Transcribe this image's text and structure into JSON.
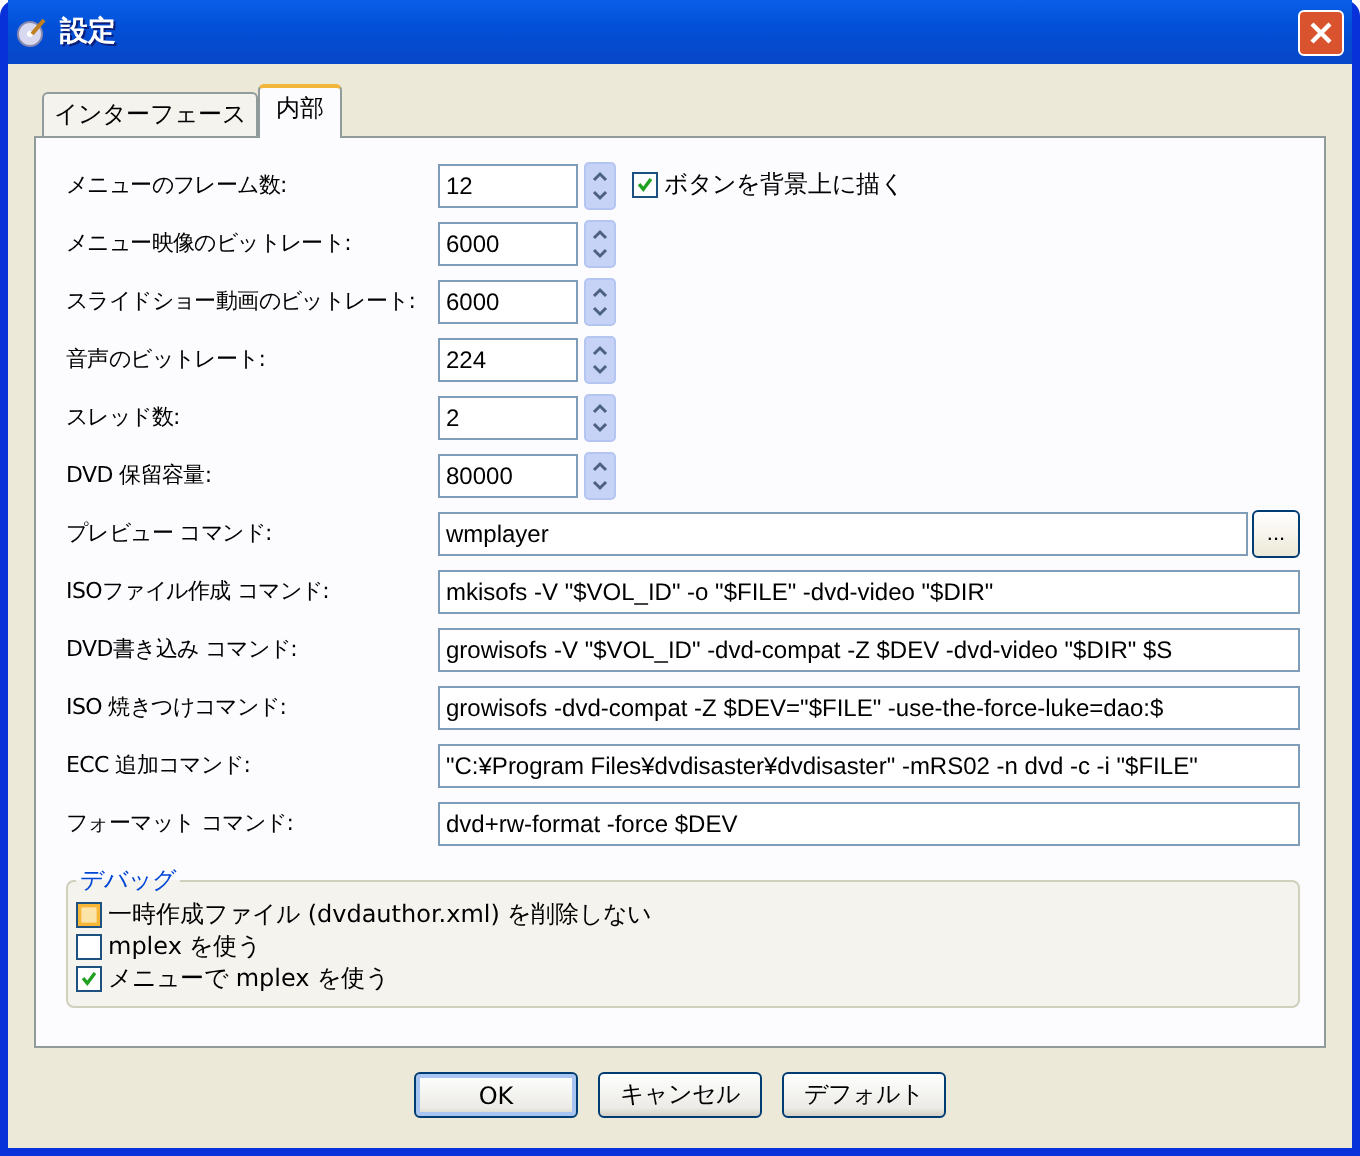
{
  "window": {
    "title": "設定"
  },
  "tabs": [
    {
      "label": "インターフェース",
      "selected": false
    },
    {
      "label": "内部",
      "selected": true
    }
  ],
  "rows": [
    {
      "label": "メニューのフレーム数:",
      "kind": "spin",
      "value": "12",
      "checkbox": {
        "label": "ボタンを背景上に描く",
        "checked": true
      }
    },
    {
      "label": "メニュー映像のビットレート:",
      "kind": "spin",
      "value": "6000"
    },
    {
      "label": "スライドショー動画のビットレート:",
      "kind": "spin",
      "value": "6000"
    },
    {
      "label": "音声のビットレート:",
      "kind": "spin",
      "value": "224"
    },
    {
      "label": "スレッド数:",
      "kind": "spin",
      "value": "2"
    },
    {
      "label": "DVD 保留容量:",
      "kind": "spin",
      "value": "80000"
    },
    {
      "label": "プレビュー コマンド:",
      "kind": "browse",
      "value": "wmplayer",
      "button": "..."
    },
    {
      "label": "ISOファイル作成 コマンド:",
      "kind": "text",
      "value": "mkisofs -V \"$VOL_ID\" -o \"$FILE\" -dvd-video \"$DIR\""
    },
    {
      "label": "DVD書き込み コマンド:",
      "kind": "text",
      "value": "growisofs -V \"$VOL_ID\" -dvd-compat -Z $DEV -dvd-video \"$DIR\" $S"
    },
    {
      "label": "ISO 焼きつけコマンド:",
      "kind": "text",
      "value": "growisofs -dvd-compat -Z $DEV=\"$FILE\" -use-the-force-luke=dao:$"
    },
    {
      "label": "ECC 追加コマンド:",
      "kind": "text",
      "value": "\"C:¥Program Files¥dvdisaster¥dvdisaster\" -mRS02 -n dvd -c -i \"$FILE\""
    },
    {
      "label": "フォーマット コマンド:",
      "kind": "text",
      "value": "dvd+rw-format -force $DEV"
    }
  ],
  "debug": {
    "title": "デバッグ",
    "options": [
      {
        "label": "一時作成ファイル (dvdauthor.xml) を削除しない",
        "checked": false,
        "hovered": true
      },
      {
        "label": "mplex を使う",
        "checked": false,
        "hovered": false
      },
      {
        "label": "メニューで mplex を使う",
        "checked": true,
        "hovered": false
      }
    ]
  },
  "buttons": [
    {
      "label": "OK",
      "default": true
    },
    {
      "label": "キャンセル",
      "default": false
    },
    {
      "label": "デフォルト",
      "default": false
    }
  ]
}
